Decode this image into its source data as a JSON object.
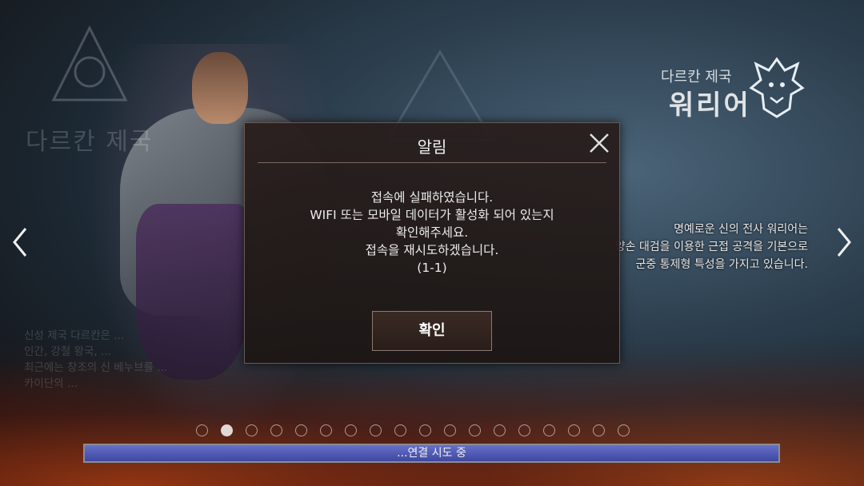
{
  "background": {
    "ghost_class_name": "다르칸 제국",
    "ghost_description": [
      "신성 제국 다르칸은 ...",
      "인간, 강철 왕국, ...",
      "최근에는 창조의 신 베누브를 ...",
      "카이단의 ..."
    ]
  },
  "class_info": {
    "nation": "다르칸 제국",
    "class_name": "워리어",
    "description": [
      "명예로운 신의 전사 워리어는",
      "양손 대검을 이용한 근접 공격을 기본으로",
      "군중 통제형 특성을 가지고 있습니다."
    ]
  },
  "dialog": {
    "title": "알림",
    "message": [
      "접속에 실패하였습니다.",
      "WIFI 또는 모바일 데이터가 활성화 되어 있는지",
      "확인해주세요.",
      "접속을 재시도하겠습니다.",
      "(1-1)"
    ],
    "confirm_label": "확인"
  },
  "pagination": {
    "total": 18,
    "active_index": 1
  },
  "progress": {
    "label": "...연결 시도 중",
    "fill_fraction": 1.0
  },
  "colors": {
    "progress_fill": "#4e58b0",
    "dialog_bg": "#2a201c",
    "accent_border": "#8a7a70"
  },
  "icons": {
    "prev": "chevron-left-icon",
    "next": "chevron-right-icon",
    "close": "close-icon",
    "emblem": "dragon-emblem-icon"
  }
}
